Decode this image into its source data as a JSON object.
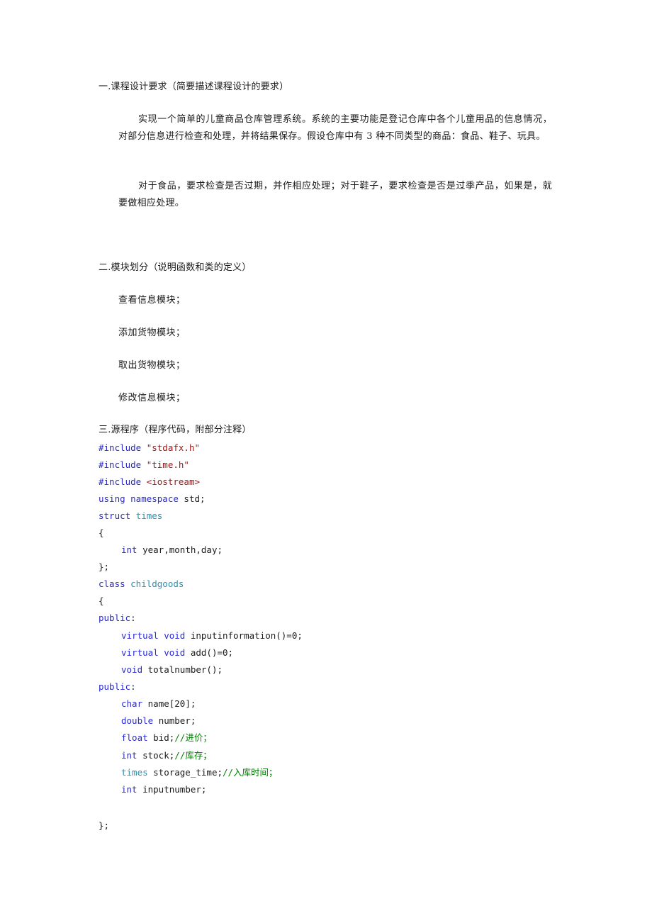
{
  "document": {
    "section1": {
      "heading": "一.课程设计要求（简要描述课程设计的要求）",
      "paragraph1": "实现一个简单的儿童商品仓库管理系统。系统的主要功能是登记仓库中各个儿童用品的信息情况，对部分信息进行检查和处理，并将结果保存。假设仓库中有 3 种不同类型的商品：食品、鞋子、玩具。",
      "paragraph2": "对于食品，要求检查是否过期，并作相应处理；对于鞋子，要求检查是否是过季产品，如果是，就要做相应处理。"
    },
    "section2": {
      "heading": "二.模块划分（说明函数和类的定义）",
      "modules": [
        "查看信息模块；",
        "添加货物模块；",
        "取出货物模块；",
        "修改信息模块；"
      ]
    },
    "section3": {
      "heading": "三.源程序（程序代码，附部分注释）",
      "code": {
        "l1": {
          "kw": "#include ",
          "str": "\"stdafx.h\""
        },
        "l2": {
          "kw": "#include ",
          "str": "\"time.h\""
        },
        "l3": {
          "kw": "#include ",
          "str": "<iostream>"
        },
        "l4": {
          "kw": "using namespace ",
          "plain": "std;"
        },
        "l5": {
          "kw": "struct ",
          "type": "times"
        },
        "l6": {
          "plain": "{"
        },
        "l7": {
          "kw": "int ",
          "plain": "year,month,day;"
        },
        "l8": {
          "plain": "};"
        },
        "l9": {
          "kw": "class ",
          "type": "childgoods"
        },
        "l10": {
          "plain": "{"
        },
        "l11": {
          "kw": "public",
          "plain": ":"
        },
        "l12": {
          "kw": "virtual void ",
          "plain": "inputinformation()=0;"
        },
        "l13": {
          "kw": "virtual void ",
          "plain": "add()=0;"
        },
        "l14": {
          "kw": "void ",
          "plain": "totalnumber();"
        },
        "l15": {
          "kw": "public",
          "plain": ":"
        },
        "l16": {
          "kw": "char ",
          "plain": "name[20];"
        },
        "l17": {
          "kw": "double ",
          "plain": "number;"
        },
        "l18": {
          "kw": "float ",
          "plain": "bid;",
          "comment": "//进价；"
        },
        "l19": {
          "kw": "int ",
          "plain": "stock;",
          "comment": "//库存；"
        },
        "l20": {
          "type": "times ",
          "plain": "storage_time;",
          "comment": "//入库时间；"
        },
        "l21": {
          "kw": "int ",
          "plain": "inputnumber;"
        },
        "l22": {
          "plain": "};"
        }
      }
    }
  },
  "colors": {
    "keyword": "#2a2ad0",
    "string": "#a31515",
    "type": "#2b91af",
    "comment": "#008000",
    "text": "#1a1a1a"
  }
}
